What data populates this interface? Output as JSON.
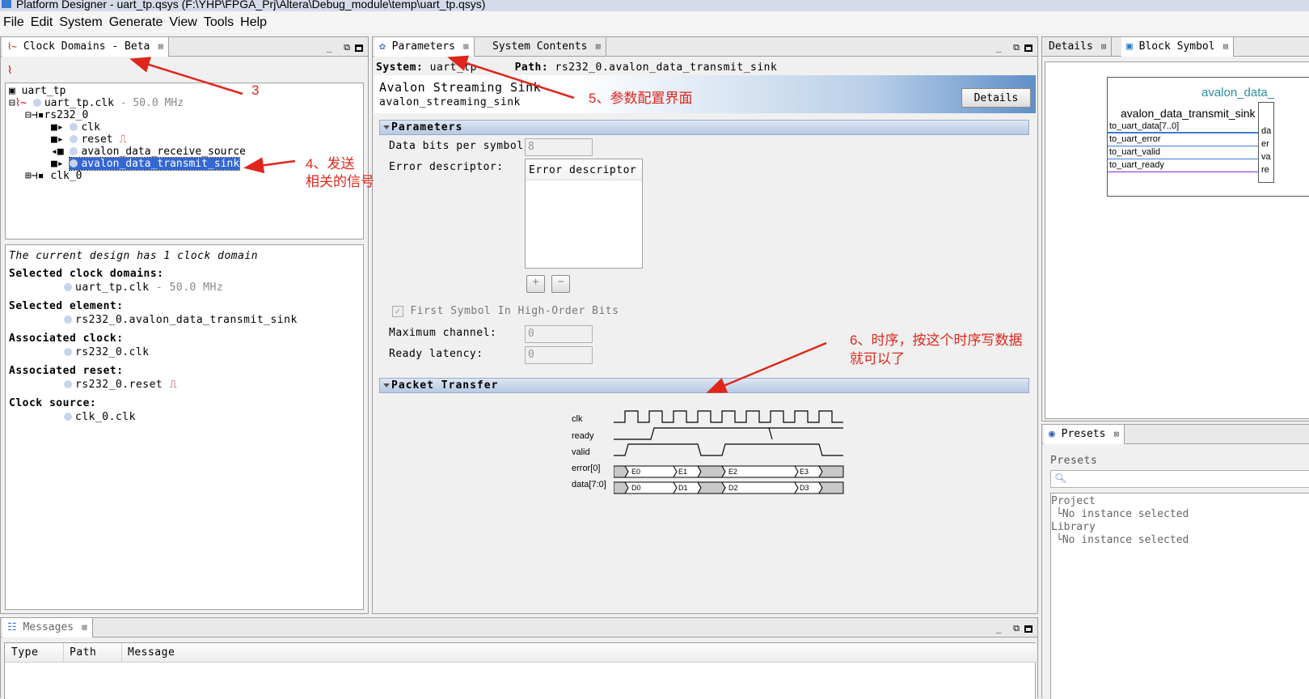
{
  "window": {
    "title": "Platform Designer - uart_tp.qsys (F:\\YHP\\FPGA_Prj\\Altera\\Debug_module\\temp\\uart_tp.qsys)"
  },
  "menu": [
    "File",
    "Edit",
    "System",
    "Generate",
    "View",
    "Tools",
    "Help"
  ],
  "clock_panel": {
    "tab": "Clock Domains - Beta",
    "tree": {
      "root": "uart_tp",
      "clock": "uart_tp.clk",
      "clock_freq": "- 50.0 MHz",
      "instance": "rs232_0",
      "children": [
        "clk",
        "reset",
        "avalon_data_receive_source",
        "avalon_data_transmit_sink"
      ],
      "other": "clk_0"
    },
    "info": {
      "summary": "The current design has 1 clock domain",
      "selected_domains_label": "Selected clock domains:",
      "selected_domain": "uart_tp.clk",
      "selected_domain_freq": "- 50.0 MHz",
      "selected_element_label": "Selected element:",
      "selected_element": "rs232_0.avalon_data_transmit_sink",
      "assoc_clock_label": "Associated clock:",
      "assoc_clock": "rs232_0.clk",
      "assoc_reset_label": "Associated reset:",
      "assoc_reset": "rs232_0.reset",
      "clock_source_label": "Clock source:",
      "clock_source": "clk_0.clk"
    }
  },
  "params_panel": {
    "tabs": [
      "Parameters",
      "System Contents"
    ],
    "system_label": "System:",
    "system_value": "uart_tp",
    "path_label": "Path:",
    "path_value": "rs232_0.avalon_data_transmit_sink",
    "heading": "Avalon Streaming Sink",
    "subheading": "avalon_streaming_sink",
    "details_button": "Details",
    "section_parameters": "Parameters",
    "data_bits_label": "Data bits per symbol:",
    "data_bits_value": "8",
    "error_desc_label": "Error descriptor:",
    "error_desc_header": "Error descriptor",
    "add_btn": "+",
    "remove_btn": "−",
    "first_symbol_label": "First Symbol In High-Order Bits",
    "max_channel_label": "Maximum channel:",
    "max_channel_value": "0",
    "ready_latency_label": "Ready latency:",
    "ready_latency_value": "0",
    "section_packet": "Packet Transfer",
    "waveform": {
      "signals": [
        "clk",
        "ready",
        "valid",
        "error[0]",
        "data[7:0]"
      ],
      "error_values": [
        "E0",
        "E1",
        "E2",
        "E3"
      ],
      "data_values": [
        "D0",
        "D1",
        "D2",
        "D3"
      ]
    }
  },
  "details_panel": {
    "tabs": [
      "Details",
      "Block Symbol"
    ],
    "block_title": "avalon_data_",
    "block_subtitle": "avalon_data_transmit_sink",
    "ports": [
      "to_uart_data[7..0]",
      "to_uart_error",
      "to_uart_valid",
      "to_uart_ready"
    ],
    "right_ports": [
      "da",
      "er",
      "va",
      "re"
    ]
  },
  "presets_panel": {
    "tab": "Presets",
    "label": "Presets",
    "project": "Project",
    "project_item": "No instance selected",
    "library": "Library",
    "library_item": "No instance selected"
  },
  "messages_panel": {
    "tab": "Messages",
    "columns": [
      "Type",
      "Path",
      "Message"
    ]
  },
  "annotations": {
    "a3": "3",
    "a4_line1": "4、发送",
    "a4_line2": "相关的信号",
    "a5": "5、参数配置界面",
    "a6_line1": "6、时序，按这个时序写数据",
    "a6_line2": "就可以了"
  },
  "colors": {
    "accent": "#3367d6",
    "annotation": "#e0261c",
    "header_gradient_start": "#b9cfe8"
  }
}
